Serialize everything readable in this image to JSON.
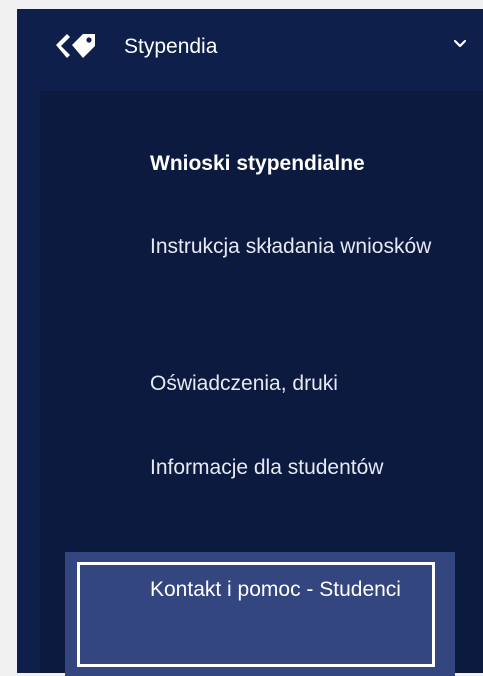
{
  "section": {
    "label": "Stypendia",
    "icon": "tags-icon",
    "expanded": true
  },
  "menu": {
    "items": [
      {
        "label": "Wnioski stypendialne",
        "state": "active"
      },
      {
        "label": "Instrukcja składania wniosków",
        "state": "normal"
      },
      {
        "label": "Oświadczenia, druki",
        "state": "normal"
      },
      {
        "label": "Informacje dla studentów",
        "state": "normal"
      },
      {
        "label": "Kontakt i pomoc - Studenci",
        "state": "selected"
      }
    ]
  },
  "colors": {
    "sidebar_background": "#0f1f4b",
    "submenu_background": "#0c1a40",
    "selected_background": "#34467f",
    "text": "#ffffff",
    "page_background": "#f1f1f1"
  }
}
